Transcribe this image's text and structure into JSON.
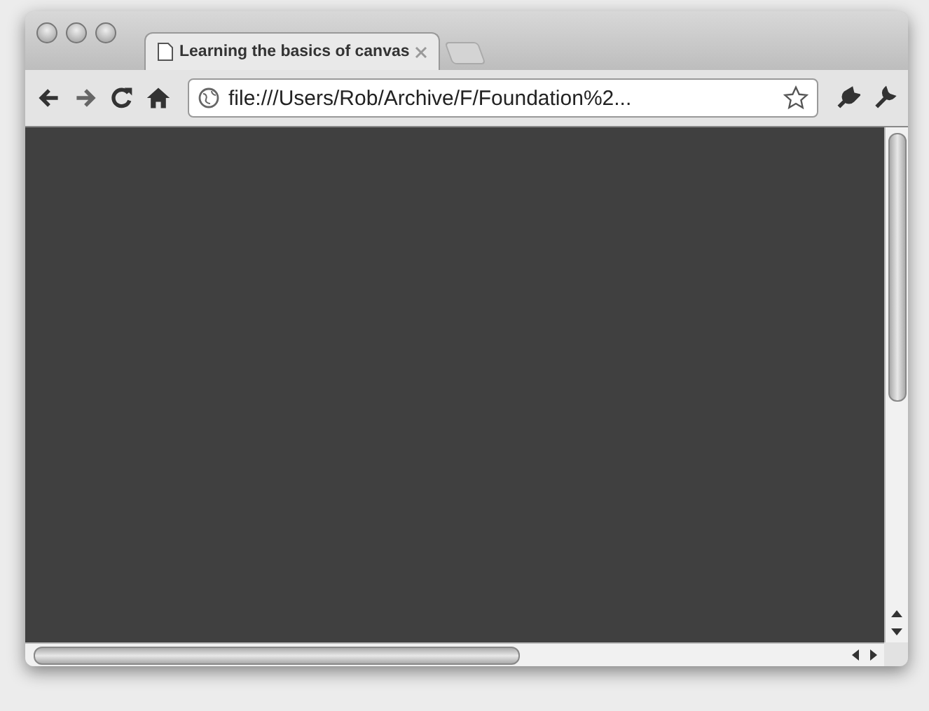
{
  "tabs": [
    {
      "title": "Learning the basics of canvas",
      "selected": true
    }
  ],
  "address_bar": {
    "value": "file:///Users/Rob/Archive/F/Foundation%2..."
  },
  "content": {
    "kind": "canvas"
  }
}
